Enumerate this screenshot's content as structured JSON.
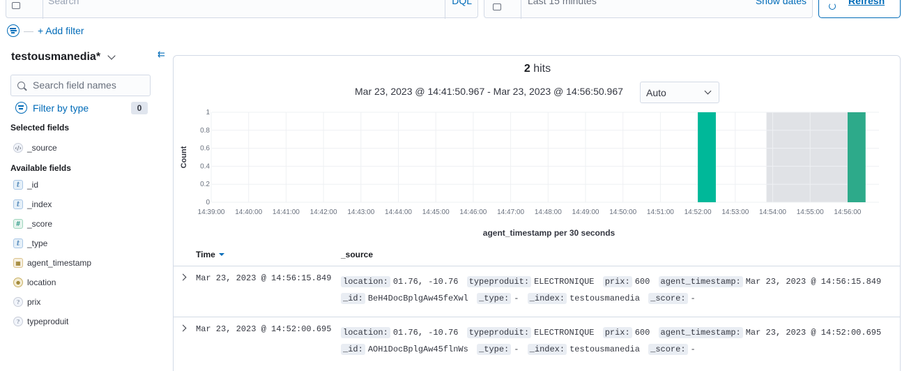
{
  "query_bar": {
    "placeholder": "Search",
    "language": "DQL"
  },
  "date_picker": {
    "value": "Last 15 minutes",
    "show_dates": "Show dates"
  },
  "refresh_label": "Refresh",
  "filters": {
    "add_filter": "+ Add filter"
  },
  "sidebar": {
    "index_pattern": "testousmanedia*",
    "search_placeholder": "Search field names",
    "filter_by_type": "Filter by type",
    "filter_count": "0",
    "selected_heading": "Selected fields",
    "selected_fields": [
      {
        "name": "_source",
        "type_icon": "code-icon"
      }
    ],
    "available_heading": "Available fields",
    "available_fields": [
      {
        "name": "_id",
        "type": "t",
        "type_icon": "string-type-icon"
      },
      {
        "name": "_index",
        "type": "t",
        "type_icon": "string-type-icon"
      },
      {
        "name": "_score",
        "type": "#",
        "type_icon": "number-type-icon"
      },
      {
        "name": "_type",
        "type": "t",
        "type_icon": "string-type-icon"
      },
      {
        "name": "agent_timestamp",
        "type": "date",
        "type_icon": "calendar-icon"
      },
      {
        "name": "location",
        "type": "geo",
        "type_icon": "globe-icon"
      },
      {
        "name": "prix",
        "type": "?",
        "type_icon": "unknown-type-icon"
      },
      {
        "name": "typeproduit",
        "type": "?",
        "type_icon": "unknown-type-icon"
      }
    ]
  },
  "hits": {
    "count": "2",
    "label": "hits"
  },
  "time_range": "Mar 23, 2023 @ 14:41:50.967 - Mar 23, 2023 @ 14:56:50.967",
  "interval": "Auto",
  "chart_data": {
    "type": "bar",
    "ylabel": "Count",
    "xlabel": "agent_timestamp per 30 seconds",
    "ylim": [
      0,
      1
    ],
    "y_ticks": [
      "0",
      "0.2",
      "0.4",
      "0.6",
      "0.8",
      "1"
    ],
    "x_ticks": [
      "14:39:00",
      "14:40:00",
      "14:41:00",
      "14:42:00",
      "14:43:00",
      "14:44:00",
      "14:45:00",
      "14:46:00",
      "14:47:00",
      "14:48:00",
      "14:49:00",
      "14:50:00",
      "14:51:00",
      "14:52:00",
      "14:53:00",
      "14:54:00",
      "14:55:00",
      "14:56:00"
    ],
    "bars": [
      {
        "x": "14:52:00",
        "value": 1
      },
      {
        "x": "14:56:00",
        "value": 1
      }
    ],
    "highlight_range": [
      "14:53:50",
      "14:56:00"
    ],
    "grid": true,
    "bar_color": "#00b899"
  },
  "table": {
    "col_time": "Time",
    "col_source": "_source",
    "rows": [
      {
        "time": "Mar 23, 2023 @ 14:56:15.849",
        "fields": [
          {
            "k": "location:",
            "v": "01.76, -10.76"
          },
          {
            "k": "typeproduit:",
            "v": "ELECTRONIQUE"
          },
          {
            "k": "prix:",
            "v": "600"
          },
          {
            "k": "agent_timestamp:",
            "v": "Mar 23, 2023 @ 14:56:15.849"
          },
          {
            "k": "_id:",
            "v": "BeH4DocBplgAw45feXwl"
          },
          {
            "k": "_type:",
            "v": "-"
          },
          {
            "k": "_index:",
            "v": "testousmanedia"
          },
          {
            "k": "_score:",
            "v": "-"
          }
        ]
      },
      {
        "time": "Mar 23, 2023 @ 14:52:00.695",
        "fields": [
          {
            "k": "location:",
            "v": "01.76, -10.76"
          },
          {
            "k": "typeproduit:",
            "v": "ELECTRONIQUE"
          },
          {
            "k": "prix:",
            "v": "600"
          },
          {
            "k": "agent_timestamp:",
            "v": "Mar 23, 2023 @ 14:52:00.695"
          },
          {
            "k": "_id:",
            "v": "AOH1DocBplgAw45flnWs"
          },
          {
            "k": "_type:",
            "v": "-"
          },
          {
            "k": "_index:",
            "v": "testousmanedia"
          },
          {
            "k": "_score:",
            "v": "-"
          }
        ]
      }
    ]
  }
}
